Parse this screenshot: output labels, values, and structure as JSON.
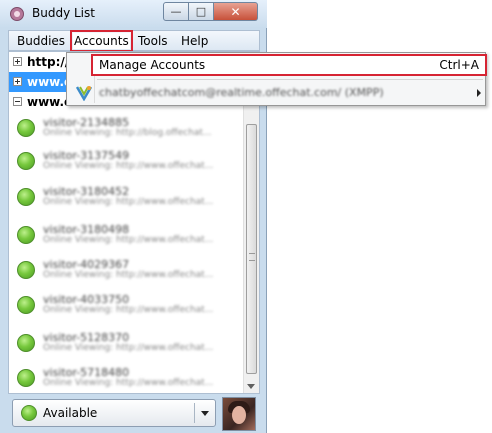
{
  "window": {
    "title": "Buddy List",
    "buttons": {
      "minimize": "—",
      "maximize": "□",
      "close": "✕"
    }
  },
  "menubar": {
    "items": [
      {
        "label": "Buddies"
      },
      {
        "label": "Accounts"
      },
      {
        "label": "Tools"
      },
      {
        "label": "Help"
      }
    ]
  },
  "groups": [
    {
      "label": "http://",
      "expanded": false
    },
    {
      "label": "www.o",
      "expanded": false,
      "selected": true
    },
    {
      "label": "www.o",
      "expanded": true
    }
  ],
  "buddies": [
    {
      "name": "visitor-2134885",
      "status": "Online Viewing: http://blog.offechat..."
    },
    {
      "name": "visitor-3137549",
      "status": "Online Viewing: http://www.offechat..."
    },
    {
      "name": "visitor-3180452",
      "status": "Online Viewing: http://www.offechat..."
    },
    {
      "name": "visitor-3180498",
      "status": "Online Viewing: http://www.offechat..."
    },
    {
      "name": "visitor-4029367",
      "status": "Online Viewing: http://www.offechat..."
    },
    {
      "name": "visitor-4033750",
      "status": "Online Viewing: http://www.offechat..."
    },
    {
      "name": "visitor-5128370",
      "status": "Online Viewing: http://www.offechat..."
    },
    {
      "name": "visitor-5718480",
      "status": "Online Viewing: http://www.offechat..."
    }
  ],
  "status_selector": {
    "label": "Available"
  },
  "accounts_menu": {
    "manage_label": "Manage Accounts",
    "manage_shortcut": "Ctrl+A",
    "account_label": "chatbyoffechatcom@realtime.offechat.com/ (XMPP)"
  },
  "colors": {
    "available": "#77c83d",
    "selection": "#3399ff",
    "highlight_outline": "#d62433"
  }
}
